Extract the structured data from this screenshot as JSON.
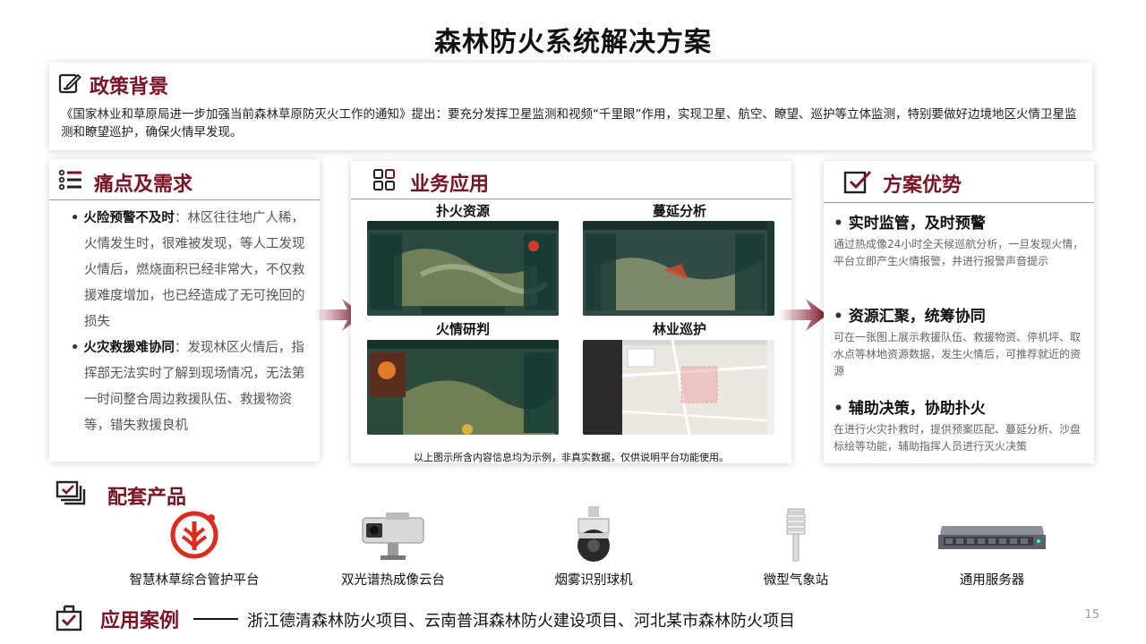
{
  "title": "森林防火系统解决方案",
  "policy": {
    "title": "政策背景",
    "body": "《国家林业和草原局进一步加强当前森林草原防灭火工作的通知》提出：要充分发挥卫星监测和视频“千里眼”作用，实现卫星、航空、瞭望、巡护等立体监测，特别要做好边境地区火情卫星监测和瞭望巡护，确保火情早发现。"
  },
  "pain": {
    "title": "痛点及需求",
    "items": [
      {
        "head": "火险预警不及时",
        "text": "：林区往往地广人稀，火情发生时，很难被发现，等人工发现火情后，燃烧面积已经非常大，不仅救援难度增加，也已经造成了无可挽回的损失"
      },
      {
        "head": "火灾救援难协同",
        "text": "：发现林区火情后，指挥部无法实时了解到现场情况，无法第一时间整合周边救援队伍、救援物资等，错失救援良机"
      }
    ]
  },
  "biz": {
    "title": "业务应用",
    "shots": [
      {
        "label": "扑火资源"
      },
      {
        "label": "蔓延分析"
      },
      {
        "label": "火情研判"
      },
      {
        "label": "林业巡护"
      }
    ],
    "note": "以上图示所含内容信息均为示例，非真实数据，仅供说明平台功能使用。"
  },
  "adv": {
    "title": "方案优势",
    "items": [
      {
        "head": "实时监管，及时预警",
        "body": "通过热成像24小时全天候巡航分析，一旦发现火情，平台立即产生火情报警，并进行报警声音提示"
      },
      {
        "head": "资源汇聚，统筹协同",
        "body": "可在一张图上展示救援队伍、救援物资、停机坪、取水点等林地资源数据，发生火情后，可推荐就近的资源"
      },
      {
        "head": "辅助决策，协助扑火",
        "body": "在进行火灾扑救时，提供预案匹配、蔓延分析、沙盘标绘等功能，辅助指挥人员进行灭火决策"
      }
    ]
  },
  "products": {
    "title": "配套产品",
    "items": [
      {
        "label": "智慧林草综合管护平台"
      },
      {
        "label": "双光谱热成像云台"
      },
      {
        "label": "烟雾识别球机"
      },
      {
        "label": "微型气象站"
      },
      {
        "label": "通用服务器"
      }
    ]
  },
  "cases": {
    "title": "应用案例",
    "text": "浙江德清森林防火项目、云南普洱森林防火建设项目、河北某市森林防火项目"
  },
  "page_number": "15",
  "colors": {
    "accent": "#7a1424"
  }
}
